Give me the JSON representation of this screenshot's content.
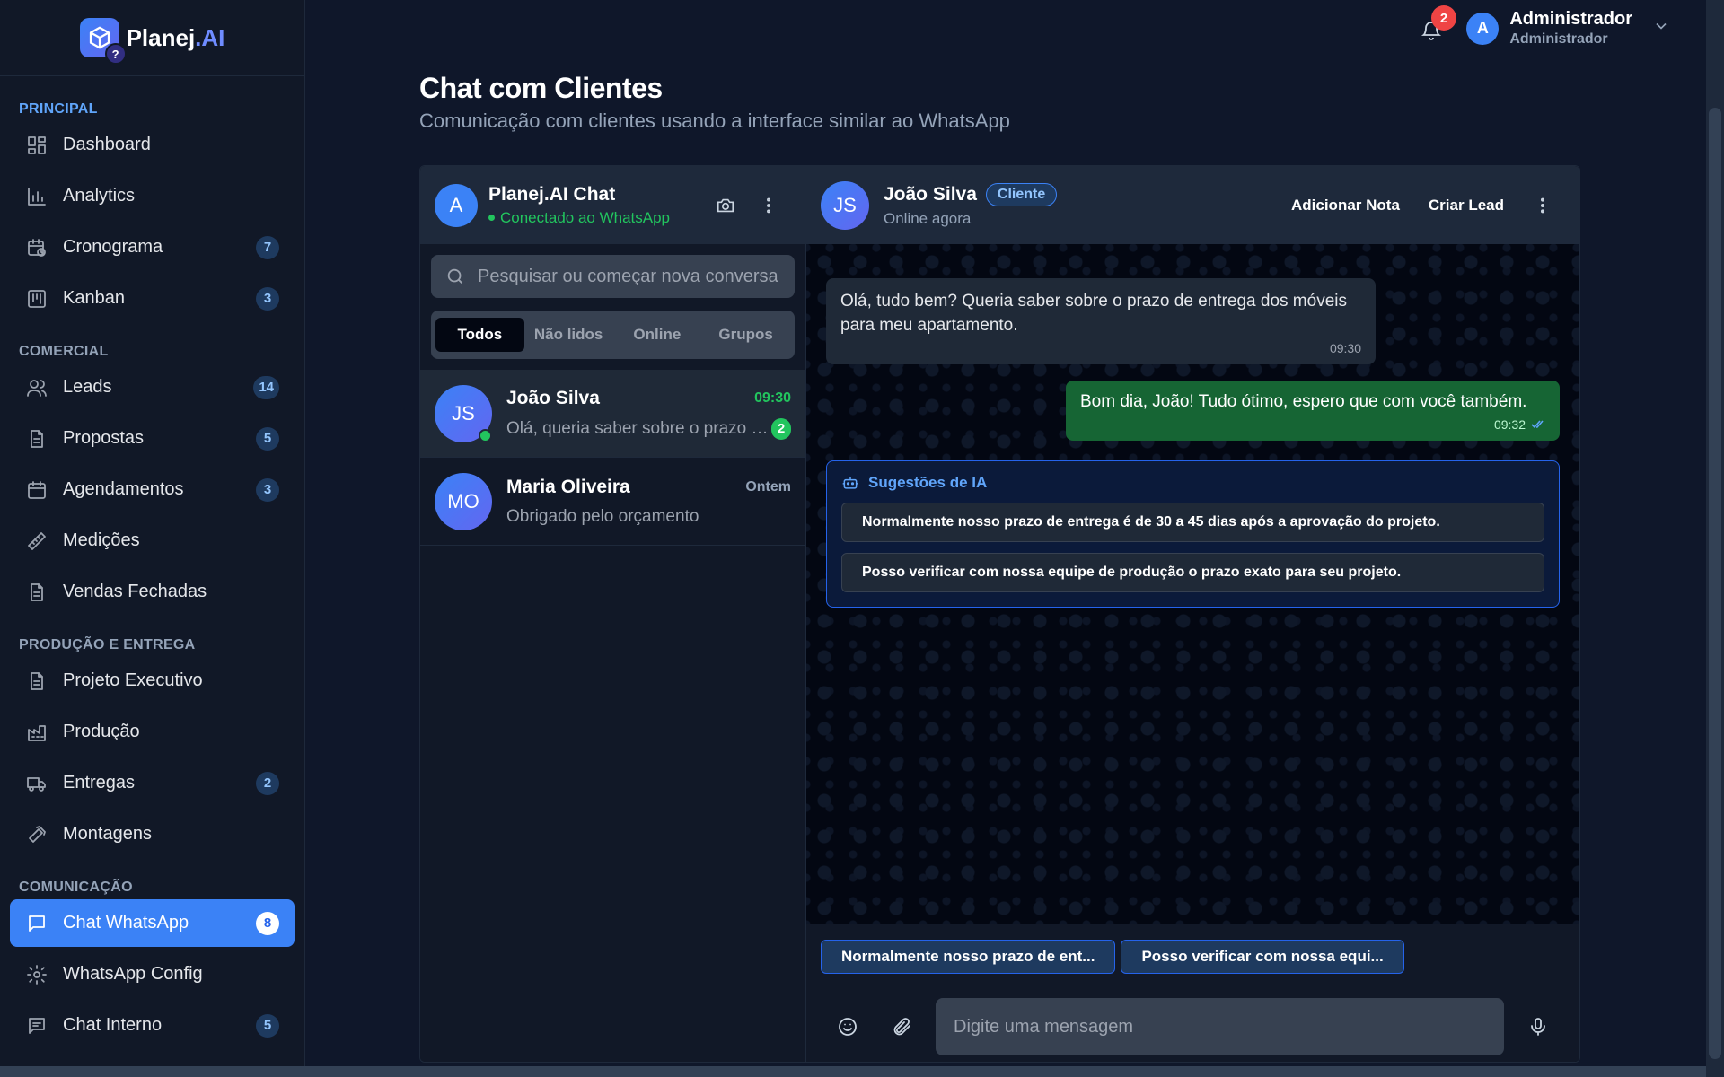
{
  "brand": {
    "name_main": "Planej",
    "name_accent": ".AI",
    "logo_badge": "?"
  },
  "sidebar": {
    "sections": [
      {
        "title": "PRINCIPAL",
        "items": [
          {
            "label": "Dashboard",
            "icon": "grid-icon",
            "count": ""
          },
          {
            "label": "Analytics",
            "icon": "bar-chart-icon",
            "count": ""
          },
          {
            "label": "Cronograma",
            "icon": "calendar-clock-icon",
            "count": "7"
          },
          {
            "label": "Kanban",
            "icon": "kanban-icon",
            "count": "3"
          }
        ]
      },
      {
        "title": "COMERCIAL",
        "items": [
          {
            "label": "Leads",
            "icon": "users-icon",
            "count": "14"
          },
          {
            "label": "Propostas",
            "icon": "document-icon",
            "count": "5"
          },
          {
            "label": "Agendamentos",
            "icon": "calendar-icon",
            "count": "3"
          },
          {
            "label": "Medições",
            "icon": "ruler-icon",
            "count": ""
          },
          {
            "label": "Vendas Fechadas",
            "icon": "document-icon",
            "count": ""
          }
        ]
      },
      {
        "title": "PRODUÇÃO E ENTREGA",
        "items": [
          {
            "label": "Projeto Executivo",
            "icon": "document-icon",
            "count": ""
          },
          {
            "label": "Produção",
            "icon": "factory-icon",
            "count": ""
          },
          {
            "label": "Entregas",
            "icon": "truck-icon",
            "count": "2"
          },
          {
            "label": "Montagens",
            "icon": "hammer-icon",
            "count": ""
          }
        ]
      },
      {
        "title": "COMUNICAÇÃO",
        "items": [
          {
            "label": "Chat WhatsApp",
            "icon": "chat-icon",
            "count": "8",
            "active": true
          },
          {
            "label": "WhatsApp Config",
            "icon": "gear-icon",
            "count": ""
          },
          {
            "label": "Chat Interno",
            "icon": "chat-lines-icon",
            "count": "5"
          }
        ]
      }
    ]
  },
  "topbar": {
    "notifications": "2",
    "user_initial": "A",
    "user_name": "Administrador",
    "user_role": "Administrador"
  },
  "page": {
    "title": "Chat com Clientes",
    "subtitle": "Comunicação com clientes usando a interface similar ao WhatsApp"
  },
  "chat_list": {
    "header_initial": "A",
    "header_title": "Planej.AI Chat",
    "header_status": "Conectado ao WhatsApp",
    "search_placeholder": "Pesquisar ou começar nova conversa",
    "filters": [
      "Todos",
      "Não lidos",
      "Online",
      "Grupos"
    ],
    "conversations": [
      {
        "initials": "JS",
        "name": "João Silva",
        "time": "09:30",
        "preview": "Olá, queria saber sobre o prazo de entrega",
        "unread": "2",
        "online": true
      },
      {
        "initials": "MO",
        "name": "Maria Oliveira",
        "time": "Ontem",
        "preview": "Obrigado pelo orçamento",
        "unread": "",
        "online": false
      }
    ]
  },
  "chat": {
    "contact_initials": "JS",
    "contact_name": "João Silva",
    "contact_badge": "Cliente",
    "contact_status": "Online agora",
    "action_note": "Adicionar Nota",
    "action_lead": "Criar Lead",
    "messages": [
      {
        "direction": "in",
        "text": "Olá, tudo bem? Queria saber sobre o prazo de entrega dos móveis para meu apartamento.",
        "time": "09:30"
      },
      {
        "direction": "out",
        "text": "Bom dia, João! Tudo ótimo, espero que com você também.",
        "time": "09:32"
      }
    ],
    "ai_title": "Sugestões de IA",
    "ai_suggestions": [
      "Normalmente nosso prazo de entrega é de 30 a 45 dias após a aprovação do projeto.",
      "Posso verificar com nossa equipe de produção o prazo exato para seu projeto."
    ],
    "quick_replies": [
      "Normalmente nosso prazo de ent...",
      "Posso verificar com nossa equi..."
    ],
    "composer_placeholder": "Digite uma mensagem"
  },
  "colors": {
    "accent": "#3b82f6",
    "sent_bubble": "#166534",
    "online": "#22c55e",
    "alert": "#ef4444"
  }
}
